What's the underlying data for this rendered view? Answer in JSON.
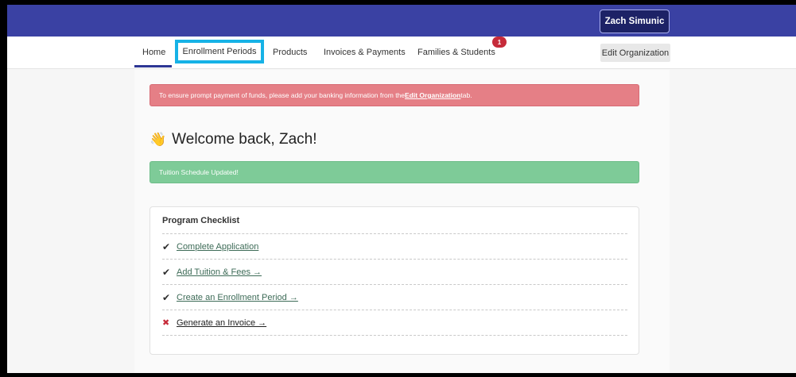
{
  "topbar": {
    "user_name": "Zach Simunic"
  },
  "nav": {
    "items": [
      {
        "label": "Home"
      },
      {
        "label": "Enrollment Periods"
      },
      {
        "label": "Products"
      },
      {
        "label": "Invoices & Payments"
      },
      {
        "label": "Families & Students"
      }
    ],
    "families_badge": "1",
    "edit_org_label": "Edit Organization"
  },
  "alerts": {
    "danger_pre": "To ensure prompt payment of funds, please add your banking information from the ",
    "danger_link": "Edit Organization",
    "danger_post": " tab.",
    "success": "Tuition Schedule Updated!"
  },
  "welcome": {
    "emoji": "👋",
    "text": "Welcome back, Zach!"
  },
  "checklist": {
    "title": "Program Checklist",
    "items": [
      {
        "label": "Complete Application",
        "status": "done",
        "icon": "✔"
      },
      {
        "label": "Add Tuition & Fees →",
        "status": "done",
        "icon": "✔"
      },
      {
        "label": "Create an Enrollment Period →",
        "status": "done",
        "icon": "✔"
      },
      {
        "label": "Generate an Invoice →",
        "status": "todo",
        "icon": "✖"
      }
    ]
  },
  "colors": {
    "header": "#3a41a3",
    "highlight": "#16b2e6",
    "danger": "#e57f86",
    "success": "#7ecb98"
  }
}
